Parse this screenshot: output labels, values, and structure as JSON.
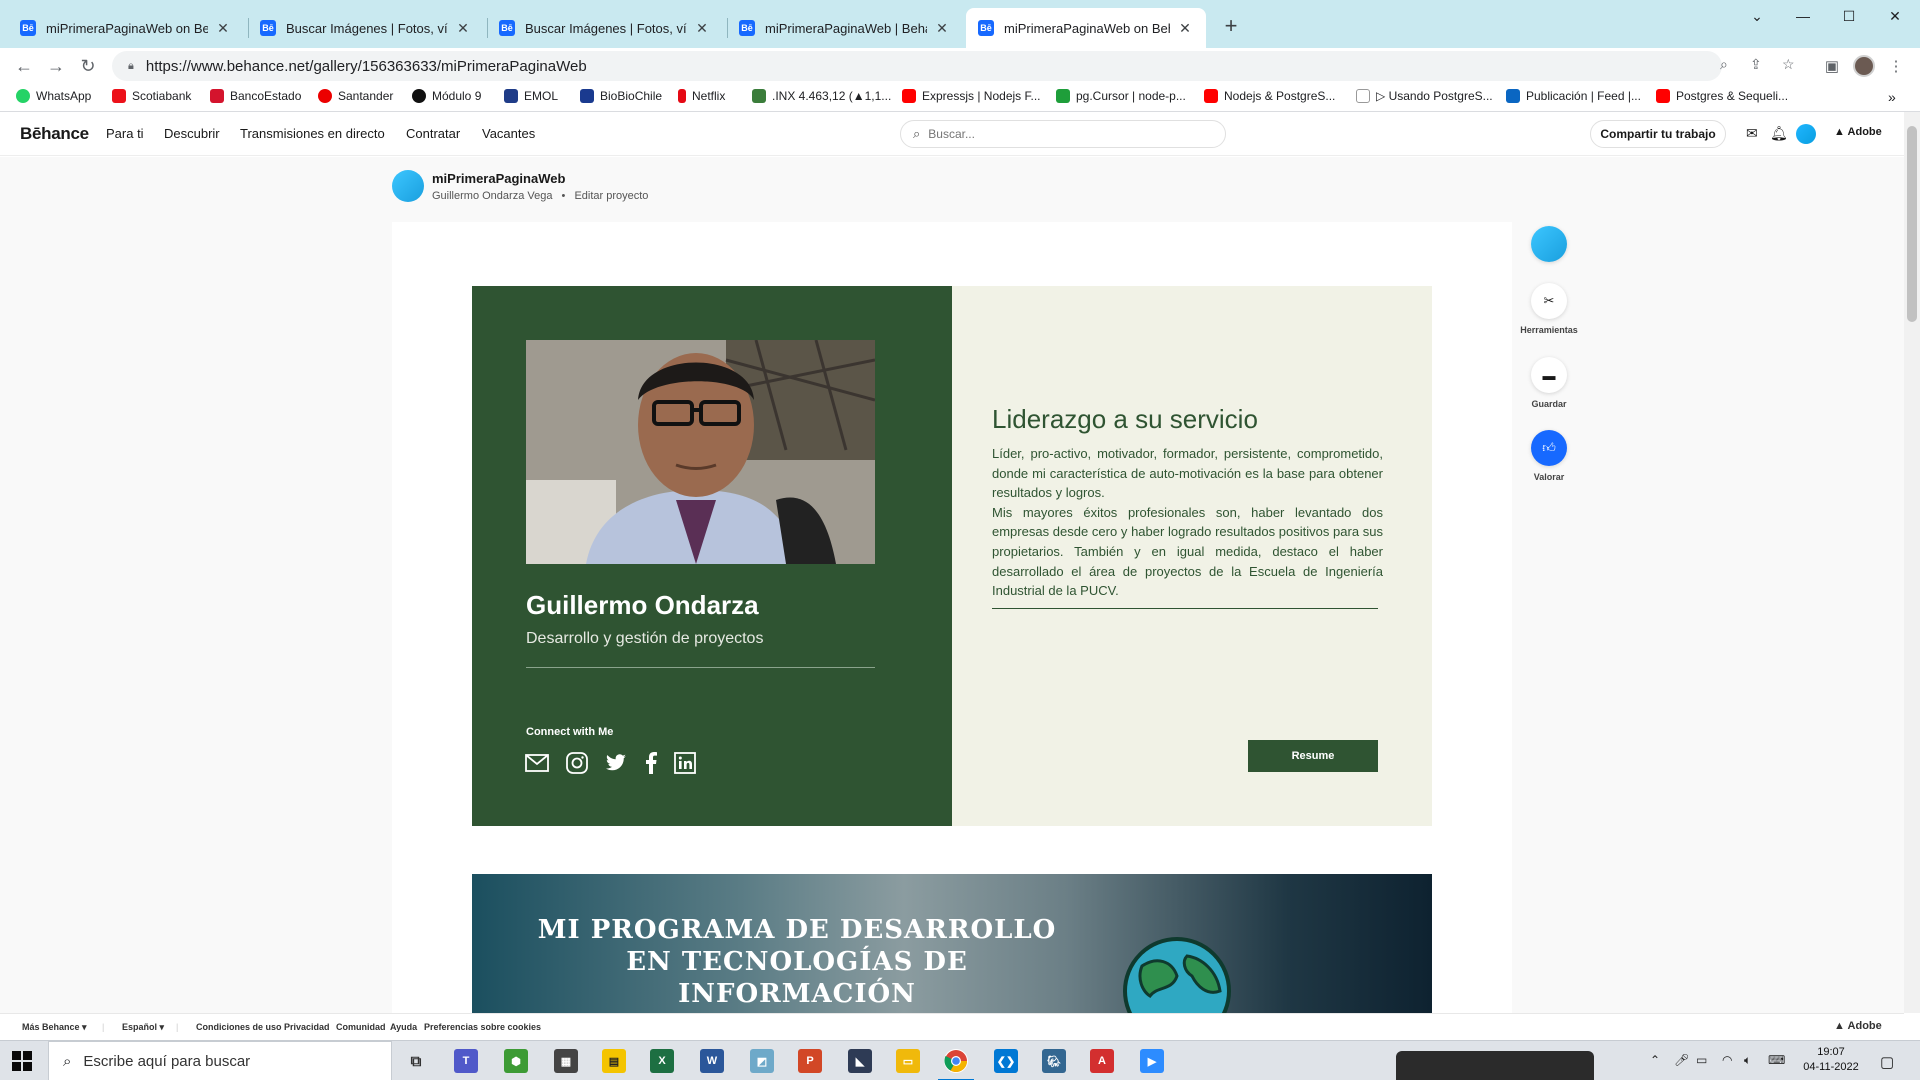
{
  "browser": {
    "tabs": [
      {
        "title": "miPrimeraPaginaWeb on Behance",
        "favicon": "Bē",
        "active": false
      },
      {
        "title": "Buscar Imágenes | Fotos, vídeos,",
        "favicon": "Bē",
        "active": false
      },
      {
        "title": "Buscar Imágenes | Fotos, vídeos,",
        "favicon": "Bē",
        "active": false
      },
      {
        "title": "miPrimeraPaginaWeb | Behance",
        "favicon": "Bē",
        "active": false
      },
      {
        "title": "miPrimeraPaginaWeb on Behance",
        "favicon": "Bē",
        "active": true
      }
    ],
    "url": "https://www.behance.net/gallery/156363633/miPrimeraPaginaWeb",
    "bookmarks": [
      {
        "label": "WhatsApp",
        "color": "#25d366"
      },
      {
        "label": "Scotiabank",
        "color": "#ec111a"
      },
      {
        "label": "BancoEstado",
        "color": "#d4142d"
      },
      {
        "label": "Santander",
        "color": "#ec0000"
      },
      {
        "label": "Módulo 9",
        "color": "#111111"
      },
      {
        "label": "EMOL",
        "color": "#1f3c88"
      },
      {
        "label": "BioBioChile",
        "color": "#1a3a8f"
      },
      {
        "label": "Netflix",
        "color": "#e50914"
      },
      {
        "label": ".INX 4.463,12 (▲1,1...",
        "color": "#3b7d3b"
      },
      {
        "label": "Expressjs | Nodejs F...",
        "color": "#ff0000"
      },
      {
        "label": "pg.Cursor | node-p...",
        "color": "#1e9e3a"
      },
      {
        "label": "Nodejs & PostgreS...",
        "color": "#ff0000"
      },
      {
        "label": "▷ Usando PostgreS...",
        "color": "#ffffff"
      },
      {
        "label": "Publicación | Feed |...",
        "color": "#0a66c2"
      },
      {
        "label": "Postgres & Sequeli...",
        "color": "#ff0000"
      }
    ]
  },
  "behance": {
    "logo": "Bēhance",
    "nav": [
      "Para ti",
      "Descubrir",
      "Transmisiones en directo",
      "Contratar",
      "Vacantes"
    ],
    "search_placeholder": "Buscar...",
    "share_label": "Compartir tu trabajo",
    "adobe_label": "Adobe",
    "project": {
      "title": "miPrimeraPaginaWeb",
      "owner": "Guillermo Ondarza Vega",
      "separator": "•",
      "edit_label": "Editar proyecto"
    },
    "rail": [
      {
        "label": "",
        "icon": "owner-avatar-icon"
      },
      {
        "label": "Herramientas",
        "icon": "tools-icon"
      },
      {
        "label": "Guardar",
        "icon": "folder-icon"
      },
      {
        "label": "Valorar",
        "icon": "thumbs-up-icon"
      }
    ],
    "footer": {
      "more": "Más Behance ▾",
      "language": "Español ▾",
      "links": [
        "Condiciones de uso",
        "Privacidad",
        "Comunidad",
        "Ayuda",
        "Preferencias sobre cookies"
      ],
      "adobe": "Adobe"
    }
  },
  "card": {
    "name": "Guillermo Ondarza",
    "role": "Desarrollo y gestión de proyectos",
    "connect_label": "Connect with Me",
    "social_icons": [
      "mail-icon",
      "instagram-icon",
      "twitter-icon",
      "facebook-icon",
      "linkedin-icon"
    ],
    "heading": "Liderazgo a su servicio",
    "paragraph1": "Líder, pro-activo, motivador, formador, persistente, comprometido, donde mi característica de auto-motivación es la base para obtener resultados y logros.",
    "paragraph2": "Mis mayores éxitos profesionales son, haber levantado dos empresas desde cero y haber logrado resultados positivos para sus propietarios. También y en igual medida, destaco el haber desarrollado el área de proyectos de la Escuela de Ingeniería Industrial de la PUCV.",
    "resume_label": "Resume",
    "colors": {
      "dark_green": "#2f5432",
      "cream": "#f1f2e6"
    }
  },
  "banner": {
    "title_line1": "MI PROGRAMA DE DESARROLLO",
    "title_line2": "EN TECNOLOGÍAS DE",
    "title_line3": "INFORMACIÓN"
  },
  "taskbar": {
    "search_placeholder": "Escribe aquí para buscar",
    "time": "19:07",
    "date": "04-11-2022"
  }
}
